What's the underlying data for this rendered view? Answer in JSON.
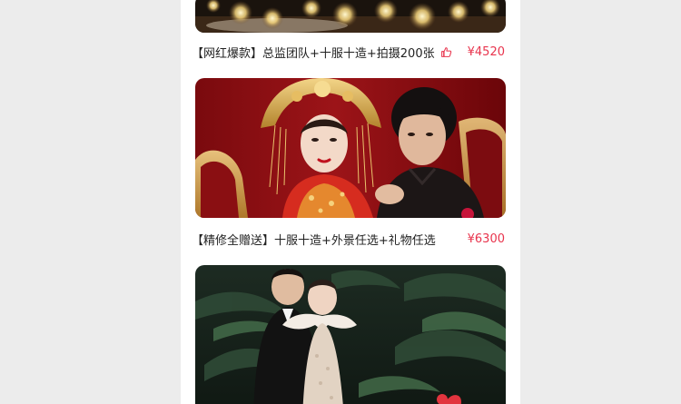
{
  "packages": [
    {
      "title": "【网红爆款】总监团队+十服十造+拍摄200张",
      "price": "¥4520",
      "liked_icon": "thumbs-up-icon",
      "image": "candlelit-bokeh-photo"
    },
    {
      "title": "【精修全赠送】十服十造+外景任选+礼物任选",
      "price": "¥6300",
      "image": "traditional-chinese-wedding-couple-photo"
    },
    {
      "image": "tropical-forest-wedding-couple-photo"
    }
  ],
  "colors": {
    "price": "#e8344d",
    "page_background": "#ececec",
    "card_background": "#ffffff"
  }
}
